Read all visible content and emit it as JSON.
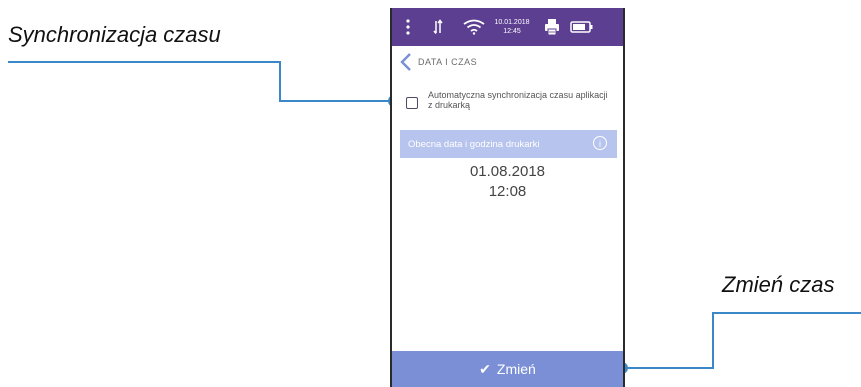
{
  "annotations": {
    "sync_caption": "Synchronizacja czasu",
    "change_caption": "Zmień czas"
  },
  "colors": {
    "statusbar": "#5d3f92",
    "accent_button": "#7a8fd6",
    "info_bar": "#b7c4ee",
    "callout_line": "#3b88c8"
  },
  "statusbar": {
    "date": "10.01.2018",
    "time": "12:45",
    "icons": [
      "menu-dots-icon",
      "sync-arrows-icon",
      "wifi-icon",
      "printer-icon",
      "battery-icon"
    ]
  },
  "header": {
    "title": "DATA I CZAS",
    "back_icon": "chevron-left-icon"
  },
  "sync_option": {
    "label": "Automatyczna synchronizacja czasu aplikacji z drukarką",
    "checked": false
  },
  "printer_time": {
    "header": "Obecna data i godzina drukarki",
    "info_icon": "info-icon",
    "date": "01.08.2018",
    "time": "12:08"
  },
  "action": {
    "label": "Zmień",
    "icon": "checkmark-icon"
  }
}
